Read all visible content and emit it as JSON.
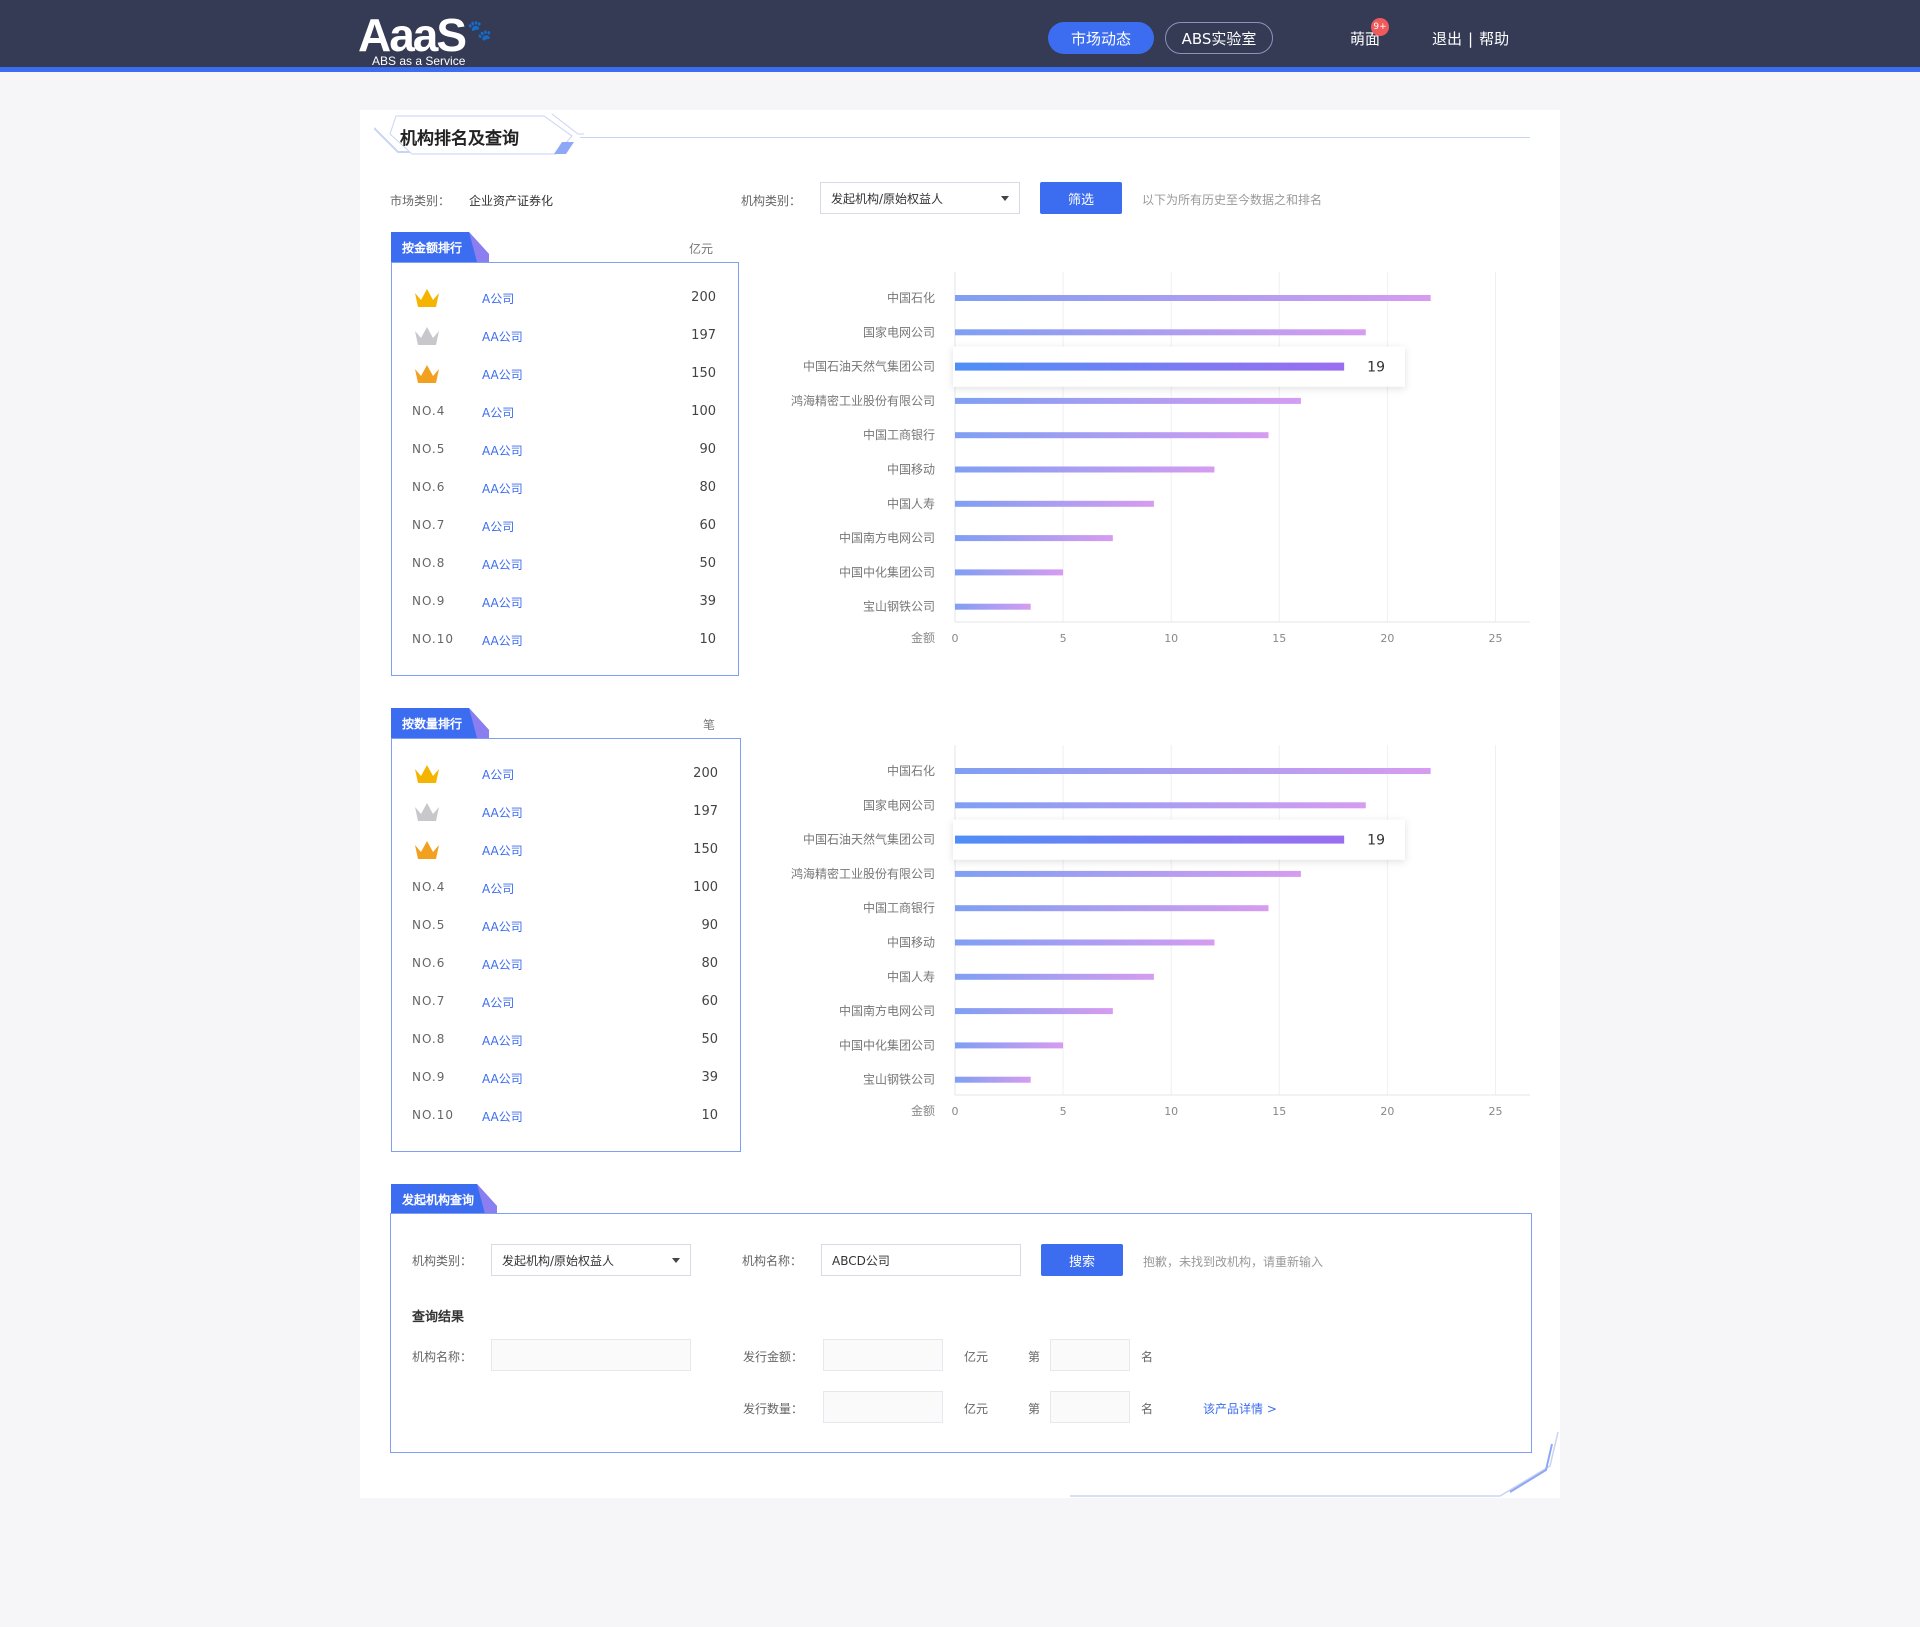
{
  "header": {
    "logo_text": "AaaS",
    "logo_subtitle": "ABS as a Service",
    "nav": [
      {
        "label": "市场动态",
        "active": true
      },
      {
        "label": "ABS实验室",
        "active": false
      }
    ],
    "user_name": "萌面",
    "badge": "9+",
    "links": [
      "退出",
      "帮助"
    ],
    "link_separator": "|"
  },
  "page": {
    "title": "机构排名及查询",
    "market_label": "市场类别：",
    "market_value": "企业资产证券化",
    "org_type_label": "机构类别：",
    "org_type_value": "发起机构/原始权益人",
    "filter_button": "筛选",
    "filter_hint": "以下为所有历史至今数据之和排名"
  },
  "amount_ranking": {
    "tab_label": "按金额排行",
    "unit": "亿元",
    "rows": [
      {
        "rank": "1",
        "name": "A公司",
        "value": "200"
      },
      {
        "rank": "2",
        "name": "AA公司",
        "value": "197"
      },
      {
        "rank": "3",
        "name": "AA公司",
        "value": "150"
      },
      {
        "rank": "NO.4",
        "name": "A公司",
        "value": "100"
      },
      {
        "rank": "NO.5",
        "name": "AA公司",
        "value": "90"
      },
      {
        "rank": "NO.6",
        "name": "AA公司",
        "value": "80"
      },
      {
        "rank": "NO.7",
        "name": "A公司",
        "value": "60"
      },
      {
        "rank": "NO.8",
        "name": "AA公司",
        "value": "50"
      },
      {
        "rank": "NO.9",
        "name": "AA公司",
        "value": "39"
      },
      {
        "rank": "NO.10",
        "name": "AA公司",
        "value": "10"
      }
    ]
  },
  "count_ranking": {
    "tab_label": "按数量排行",
    "unit": "笔",
    "rows": [
      {
        "rank": "1",
        "name": "A公司",
        "value": "200"
      },
      {
        "rank": "2",
        "name": "AA公司",
        "value": "197"
      },
      {
        "rank": "3",
        "name": "AA公司",
        "value": "150"
      },
      {
        "rank": "NO.4",
        "name": "A公司",
        "value": "100"
      },
      {
        "rank": "NO.5",
        "name": "AA公司",
        "value": "90"
      },
      {
        "rank": "NO.6",
        "name": "AA公司",
        "value": "80"
      },
      {
        "rank": "NO.7",
        "name": "A公司",
        "value": "60"
      },
      {
        "rank": "NO.8",
        "name": "AA公司",
        "value": "50"
      },
      {
        "rank": "NO.9",
        "name": "AA公司",
        "value": "39"
      },
      {
        "rank": "NO.10",
        "name": "AA公司",
        "value": "10"
      }
    ]
  },
  "colors": {
    "header_bg": "#353a55",
    "accent": "#3c6df0",
    "bar_start": "#7f9ff3",
    "bar_end": "#d69cf0",
    "highlight_start": "#4f8ef7",
    "highlight_end": "#9b6ef0",
    "gold": "#f5b400",
    "silver": "#c8c8cc",
    "bronze": "#f2a020"
  },
  "chart_data": [
    {
      "type": "bar",
      "orientation": "horizontal",
      "categories": [
        "中国石化",
        "国家电网公司",
        "中国石油天然气集团公司",
        "鸿海精密工业股份有限公司",
        "中国工商银行",
        "中国移动",
        "中国人寿",
        "中国南方电网公司",
        "中国中化集团公司",
        "宝山钢铁公司"
      ],
      "values": [
        22,
        19,
        18,
        16,
        14.5,
        12,
        9.2,
        7.3,
        5,
        3.5
      ],
      "xlabel": "金额",
      "xlim": [
        0,
        25
      ],
      "xticks": [
        0,
        5,
        10,
        15,
        20,
        25
      ],
      "highlight_index": 2,
      "tooltip_value": "19",
      "grid": true
    },
    {
      "type": "bar",
      "orientation": "horizontal",
      "categories": [
        "中国石化",
        "国家电网公司",
        "中国石油天然气集团公司",
        "鸿海精密工业股份有限公司",
        "中国工商银行",
        "中国移动",
        "中国人寿",
        "中国南方电网公司",
        "中国中化集团公司",
        "宝山钢铁公司"
      ],
      "values": [
        22,
        19,
        18,
        16,
        14.5,
        12,
        9.2,
        7.3,
        5,
        3.5
      ],
      "xlabel": "金额",
      "xlim": [
        0,
        25
      ],
      "xticks": [
        0,
        5,
        10,
        15,
        20,
        25
      ],
      "highlight_index": 2,
      "tooltip_value": "19",
      "grid": true
    }
  ],
  "query": {
    "tab_label": "发起机构查询",
    "org_type_label": "机构类别：",
    "org_type_value": "发起机构/原始权益人",
    "org_name_label": "机构名称：",
    "org_name_value": "ABCD公司",
    "search_button": "搜索",
    "not_found_hint": "抱歉，未找到改机构，请重新输入",
    "result_title": "查询结果",
    "result_name_label": "机构名称：",
    "issue_amount_label": "发行金额：",
    "issue_count_label": "发行数量：",
    "unit_amount": "亿元",
    "unit_count": "亿元",
    "rank_prefix": "第",
    "rank_suffix": "名",
    "detail_link": "该产品详情 >"
  }
}
